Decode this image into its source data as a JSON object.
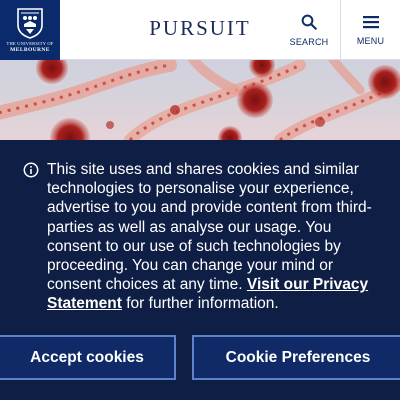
{
  "header": {
    "logo": {
      "line1": "THE UNIVERSITY OF",
      "line2": "MELBOURNE"
    },
    "brand": "PURSUIT",
    "search_label": "SEARCH",
    "menu_label": "MENU",
    "icons": {
      "search": "search-icon",
      "menu": "hamburger-menu-icon"
    }
  },
  "hero": {
    "description_icon": "hero-image"
  },
  "cookie_banner": {
    "icon": "info-icon",
    "text_before_link": "This site uses and shares cookies and similar technologies to personalise your experience, advertise to you and provide content from third-parties as well as analyse our usage. You consent to our use of such technologies by proceeding. You can change your mind or consent choices at any time. ",
    "link_text": "Visit our Privacy Statement",
    "text_after_link": " for further information.",
    "accept_label": "Accept cookies",
    "preferences_label": "Cookie Preferences"
  },
  "colors": {
    "header_bg": "#ffffff",
    "logo_bg": "#0a2a6b",
    "banner_bg": "#0f1e45",
    "button_border": "#5e82c9",
    "brand_text": "#1b2b57"
  }
}
